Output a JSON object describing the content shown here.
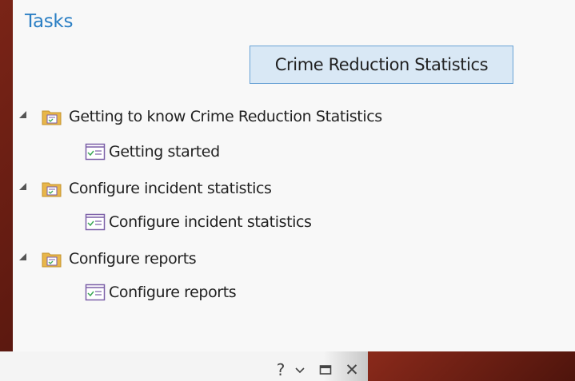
{
  "pane": {
    "title": "Tasks",
    "project_button": "Crime Reduction Statistics"
  },
  "tree": [
    {
      "group": "Getting to know Crime Reduction Statistics",
      "task": "Getting started"
    },
    {
      "group": "Configure incident statistics",
      "task": "Configure incident statistics"
    },
    {
      "group": "Configure reports",
      "task": "Configure reports"
    }
  ],
  "window_controls": {
    "help": "?",
    "menu_icon": "chevron-down-icon",
    "maximize_icon": "maximize-icon",
    "close": "✕"
  },
  "colors": {
    "title": "#2b7fc4",
    "folder": "#e8b64a",
    "task_icon": "#7b5ea7",
    "check": "#3aa655"
  }
}
